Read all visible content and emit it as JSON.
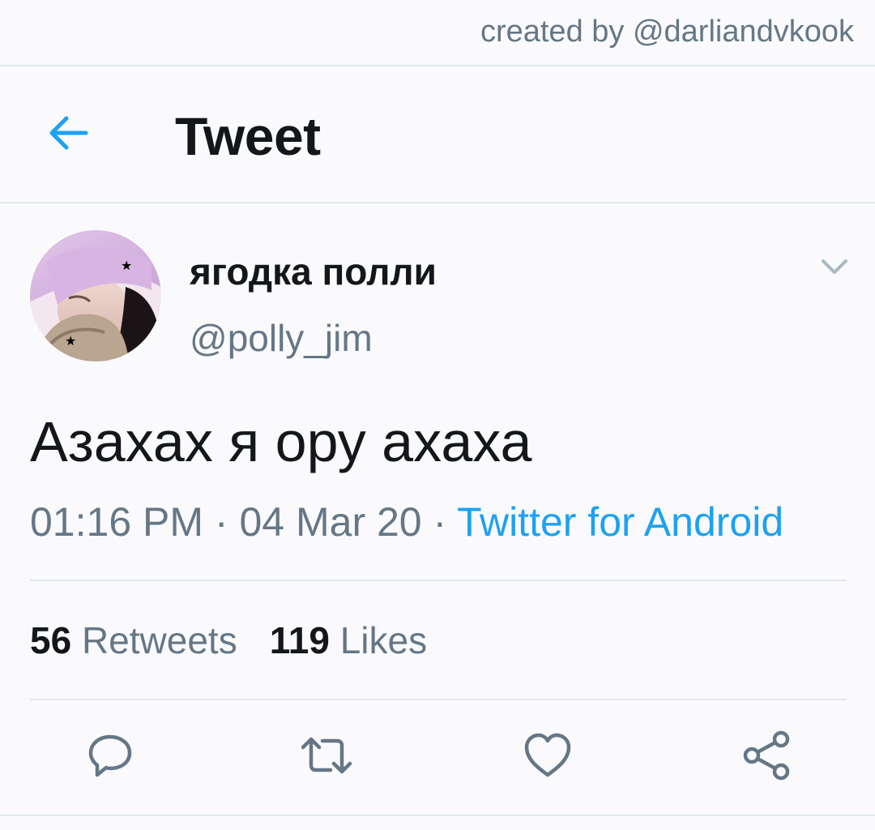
{
  "watermark": "created by @darliandvkook",
  "header": {
    "title": "Tweet",
    "back_icon": "arrow-left-icon"
  },
  "tweet": {
    "author": {
      "display_name": "ягодка полли",
      "handle": "@polly_jim"
    },
    "text": "Азахах я ору ахаха",
    "time": "01:16 PM",
    "separator": "·",
    "date": "04 Mar 20",
    "source": "Twitter for Android",
    "stats": {
      "retweets_count": "56",
      "retweets_label": "Retweets",
      "likes_count": "119",
      "likes_label": "Likes"
    },
    "actions": [
      "reply-icon",
      "retweet-icon",
      "like-icon",
      "share-icon"
    ]
  },
  "colors": {
    "accent": "#1da1f2",
    "secondary_text": "#657786",
    "primary_text": "#14171a",
    "divider": "#e1e8ed",
    "icon": "#657786"
  }
}
